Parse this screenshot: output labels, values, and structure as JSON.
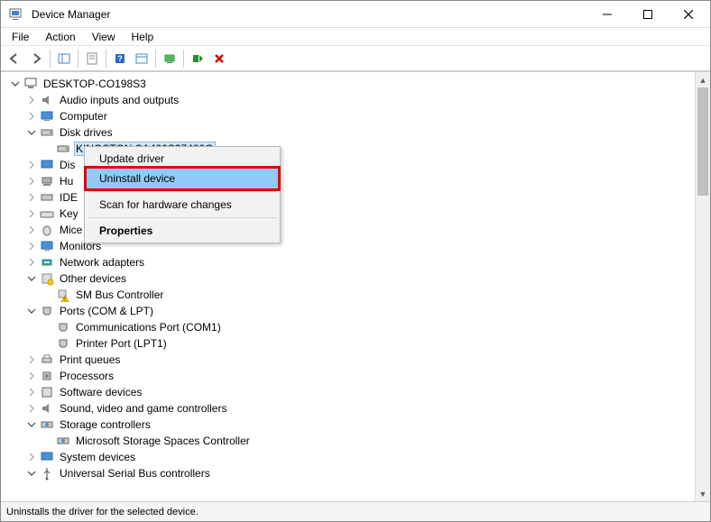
{
  "window": {
    "title": "Device Manager"
  },
  "menu": {
    "file": "File",
    "action": "Action",
    "view": "View",
    "help": "Help"
  },
  "tree": {
    "root": "DESKTOP-CO198S3",
    "audio": "Audio inputs and outputs",
    "computer": "Computer",
    "disk": "Disk drives",
    "disk_item": "KINGSTON SA400S37480G",
    "display": "Dis",
    "hid": "Hu",
    "ide": "IDE",
    "keyboards": "Key",
    "mice": "Mice and other pointing devices",
    "monitors": "Monitors",
    "network": "Network adapters",
    "other": "Other devices",
    "smbus": "SM Bus Controller",
    "ports": "Ports (COM & LPT)",
    "com1": "Communications Port (COM1)",
    "lpt1": "Printer Port (LPT1)",
    "printq": "Print queues",
    "processors": "Processors",
    "software": "Software devices",
    "sound": "Sound, video and game controllers",
    "storage": "Storage controllers",
    "msss": "Microsoft Storage Spaces Controller",
    "system": "System devices",
    "usb": "Universal Serial Bus controllers"
  },
  "context": {
    "update": "Update driver",
    "uninstall": "Uninstall device",
    "scan": "Scan for hardware changes",
    "properties": "Properties"
  },
  "status": "Uninstalls the driver for the selected device."
}
